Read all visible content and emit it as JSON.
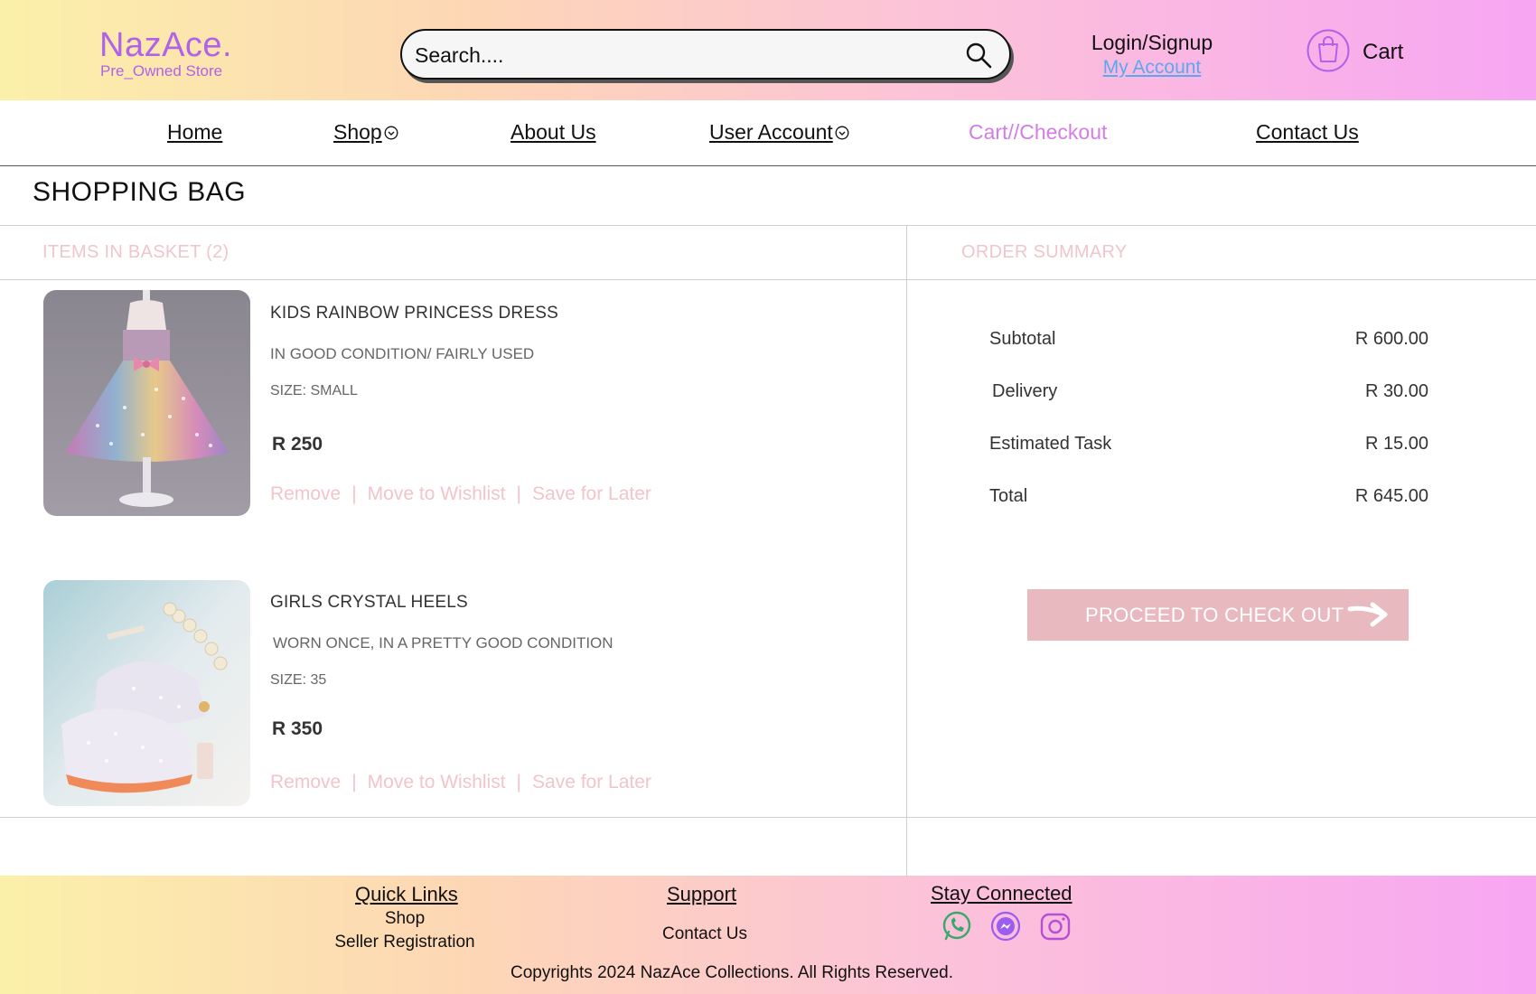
{
  "header": {
    "logo_name": "NazAce.",
    "logo_tagline": "Pre_Owned Store",
    "search_placeholder": "Search....",
    "login_label": "Login/Signup",
    "account_link": "My Account",
    "cart_label": "Cart"
  },
  "nav": {
    "items": [
      "Home",
      "Shop",
      "About Us",
      "User Account",
      "Cart//Checkout",
      "Contact Us"
    ]
  },
  "page_title": "SHOPPING BAG",
  "basket": {
    "heading": "ITEMS IN BASKET (2)",
    "items": [
      {
        "name": "KIDS RAINBOW PRINCESS DRESS",
        "condition": "IN GOOD CONDITION/ FAIRLY USED",
        "size": "SIZE: SMALL",
        "price": "R 250",
        "remove": "Remove",
        "wishlist": "Move to Wishlist",
        "later": "Save for Later",
        "sep": "|"
      },
      {
        "name": "GIRLS CRYSTAL HEELS",
        "condition": "WORN ONCE, IN  A PRETTY GOOD CONDITION",
        "size": "SIZE: 35",
        "price": "R 350",
        "remove": "Remove",
        "wishlist": "Move to Wishlist",
        "later": "Save for Later",
        "sep": "|"
      }
    ]
  },
  "summary": {
    "heading": "ORDER SUMMARY",
    "rows": [
      {
        "label": "Subtotal",
        "value": "R 600.00"
      },
      {
        "label": "Delivery",
        "value": "R 30.00"
      },
      {
        "label": "Estimated Task",
        "value": "R 15.00"
      },
      {
        "label": "Total",
        "value": "R 645.00"
      }
    ],
    "checkout_label": "PROCEED TO CHECK OUT"
  },
  "footer": {
    "quick_links_heading": "Quick Links",
    "quick_links": [
      "Shop",
      "Seller Registration"
    ],
    "support_heading": "Support",
    "support_links": [
      "Contact Us"
    ],
    "stay_connected_heading": "Stay Connected",
    "social_icons": [
      "whatsapp-icon",
      "messenger-icon",
      "instagram-icon"
    ],
    "copyright": "Copyrights 2024 NazAce Collections. All Rights Reserved."
  },
  "colors": {
    "brand_purple": "#b062e8",
    "link_blue": "#5aa8f0",
    "pink_muted": "#f0c6cc",
    "checkout_button": "#e8b9be",
    "nav_active": "#d47de6"
  }
}
